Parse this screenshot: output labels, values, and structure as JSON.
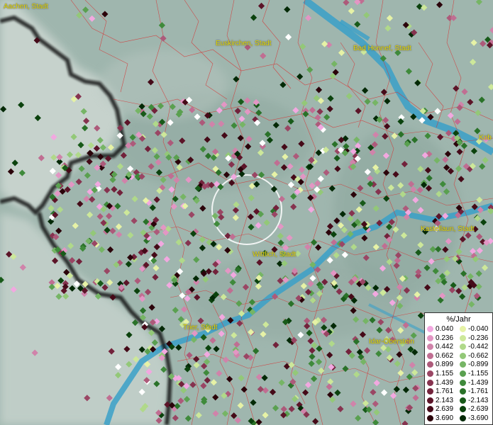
{
  "cities": [
    {
      "id": "aachen",
      "name": "Aachen, Stadt"
    },
    {
      "id": "euskirchen",
      "name": "Euskirchen, Stadt"
    },
    {
      "id": "bad-honnef",
      "name": "Bad Honnef, Stadt"
    },
    {
      "id": "koblenz",
      "name": "Kob"
    },
    {
      "id": "kastellaun",
      "name": "Kastellaun, Stadt"
    },
    {
      "id": "wittlich",
      "name": "Wittlich, Stadt"
    },
    {
      "id": "trier",
      "name": "Trier, Stadt"
    },
    {
      "id": "idar-oberstein",
      "name": "Idar-Oberstein"
    }
  ],
  "legend": {
    "title": "%/Jahr",
    "positive": [
      {
        "value": "0.040",
        "color": "#f2a8e0"
      },
      {
        "value": "0.236",
        "color": "#e396c4"
      },
      {
        "value": "0.442",
        "color": "#d083aa"
      },
      {
        "value": "0.662",
        "color": "#c06e92"
      },
      {
        "value": "0.899",
        "color": "#ad5a7a"
      },
      {
        "value": "1.155",
        "color": "#9a4664"
      },
      {
        "value": "1.439",
        "color": "#86334f"
      },
      {
        "value": "1.761",
        "color": "#72223b"
      },
      {
        "value": "2.143",
        "color": "#5c1428"
      },
      {
        "value": "2.639",
        "color": "#450a18"
      },
      {
        "value": "3.690",
        "color": "#2b030a"
      }
    ],
    "negative": [
      {
        "value": "-0.040",
        "color": "#e6f2a6"
      },
      {
        "value": "-0.236",
        "color": "#cde89a"
      },
      {
        "value": "-0.442",
        "color": "#b0d98a"
      },
      {
        "value": "-0.662",
        "color": "#93c878"
      },
      {
        "value": "-0.899",
        "color": "#76b565"
      },
      {
        "value": "-1.155",
        "color": "#5aa050"
      },
      {
        "value": "-1.439",
        "color": "#3f8a3b"
      },
      {
        "value": "-1.761",
        "color": "#2a7229"
      },
      {
        "value": "-2.143",
        "color": "#185a19"
      },
      {
        "value": "-2.639",
        "color": "#0b420d"
      },
      {
        "value": "-3.690",
        "color": "#032906"
      }
    ]
  }
}
